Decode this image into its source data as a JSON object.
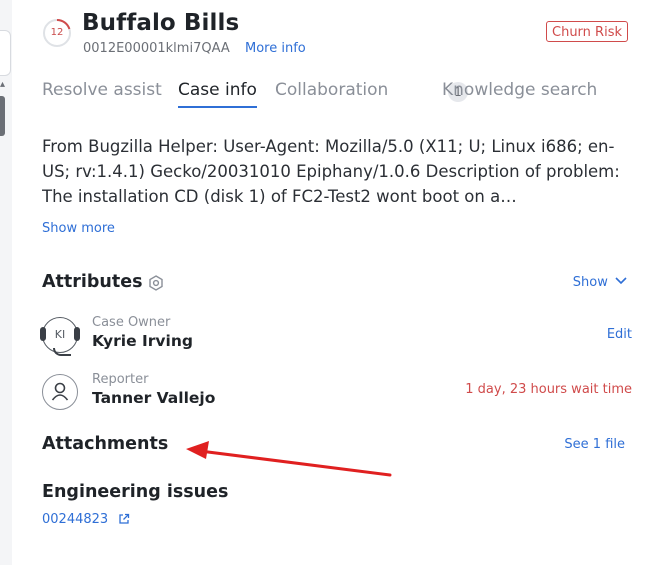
{
  "header": {
    "count": "12",
    "title": "Buffalo Bills",
    "case_id": "0012E00001klmi7QAA",
    "more_info": "More info",
    "badge": "Churn Risk"
  },
  "tabs": [
    {
      "label": "Resolve assist",
      "active": false
    },
    {
      "label": "Case info",
      "active": true
    },
    {
      "label": "Collaboration",
      "active": false,
      "count": "1"
    },
    {
      "label": "Knowledge search",
      "active": false
    }
  ],
  "description": {
    "text": "From Bugzilla Helper: User-Agent: Mozilla/5.0 (X11; U; Linux i686; en-US; rv:1.4.1) Gecko/20031010 Epiphany/1.0.6 Description of problem: The installation CD (disk 1) of FC2-Test2 wont boot on a…",
    "show_more": "Show more"
  },
  "attributes": {
    "title": "Attributes",
    "show_label": "Show"
  },
  "case_owner": {
    "initials": "KI",
    "role": "Case Owner",
    "name": "Kyrie Irving",
    "edit": "Edit"
  },
  "reporter": {
    "role": "Reporter",
    "name": "Tanner Vallejo",
    "wait": "1 day, 23 hours wait time"
  },
  "attachments": {
    "title": "Attachments",
    "see_files": "See 1 file"
  },
  "engineering": {
    "title": "Engineering issues",
    "issue_id": "00244823"
  },
  "colors": {
    "accent": "#2f6fd6",
    "danger": "#d04b4b",
    "annotation_arrow": "#e02020"
  }
}
